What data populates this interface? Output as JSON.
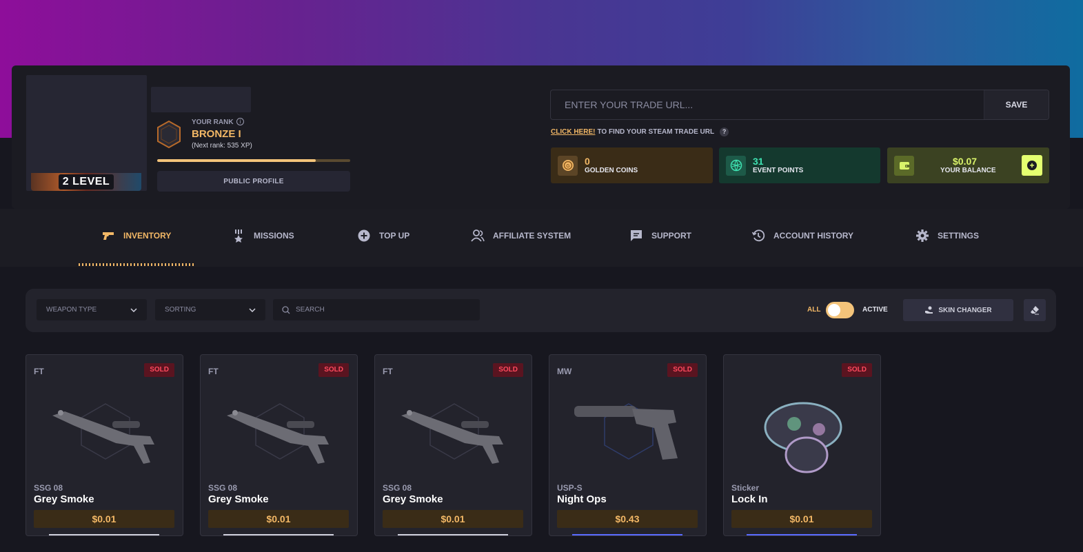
{
  "profile": {
    "level_badge": "2 LEVEL",
    "rank_label": "YOUR RANK",
    "rank_name": "BRONZE I",
    "next_rank": "(Next rank: 535 XP)",
    "xp_progress_percent": 82,
    "public_profile_label": "PUBLIC PROFILE"
  },
  "trade": {
    "placeholder": "ENTER YOUR TRADE URL...",
    "save_label": "SAVE",
    "help_link": "CLICK HERE!",
    "help_text": "TO FIND YOUR STEAM TRADE URL",
    "help_q": "?"
  },
  "stats": {
    "coins": {
      "value": "0",
      "label": "GOLDEN COINS",
      "icon": "coin-icon"
    },
    "events": {
      "value": "31",
      "label": "EVENT POINTS",
      "icon": "globe-icon"
    },
    "balance": {
      "value": "$0.07",
      "label": "YOUR BALANCE",
      "icon": "wallet-icon"
    }
  },
  "nav": {
    "items": [
      {
        "label": "INVENTORY",
        "icon": "pistol-icon",
        "active": true
      },
      {
        "label": "MISSIONS",
        "icon": "medal-icon",
        "active": false
      },
      {
        "label": "TOP UP",
        "icon": "plus-circle-icon",
        "active": false
      },
      {
        "label": "AFFILIATE SYSTEM",
        "icon": "users-icon",
        "active": false
      },
      {
        "label": "SUPPORT",
        "icon": "chat-icon",
        "active": false
      },
      {
        "label": "ACCOUNT HISTORY",
        "icon": "history-icon",
        "active": false
      },
      {
        "label": "SETTINGS",
        "icon": "gear-icon",
        "active": false
      }
    ]
  },
  "filters": {
    "weapon_type": "WEAPON TYPE",
    "sorting": "SORTING",
    "search_placeholder": "SEARCH",
    "toggle_all": "ALL",
    "toggle_active": "ACTIVE",
    "skin_changer": "SKIN CHANGER"
  },
  "items": [
    {
      "wear": "FT",
      "status": "SOLD",
      "weapon": "SSG 08",
      "name": "Grey Smoke",
      "price": "$0.01"
    },
    {
      "wear": "FT",
      "status": "SOLD",
      "weapon": "SSG 08",
      "name": "Grey Smoke",
      "price": "$0.01"
    },
    {
      "wear": "FT",
      "status": "SOLD",
      "weapon": "SSG 08",
      "name": "Grey Smoke",
      "price": "$0.01"
    },
    {
      "wear": "MW",
      "status": "SOLD",
      "weapon": "USP-S",
      "name": "Night Ops",
      "price": "$0.43"
    },
    {
      "wear": "",
      "status": "SOLD",
      "weapon": "Sticker",
      "name": "Lock In",
      "price": "$0.01"
    }
  ],
  "colors": {
    "accent": "#f3b866",
    "sold_bg": "#5a1420",
    "sold_text": "#ff4a5e",
    "events": "#3fe3b2",
    "balance": "#d9f36a"
  }
}
